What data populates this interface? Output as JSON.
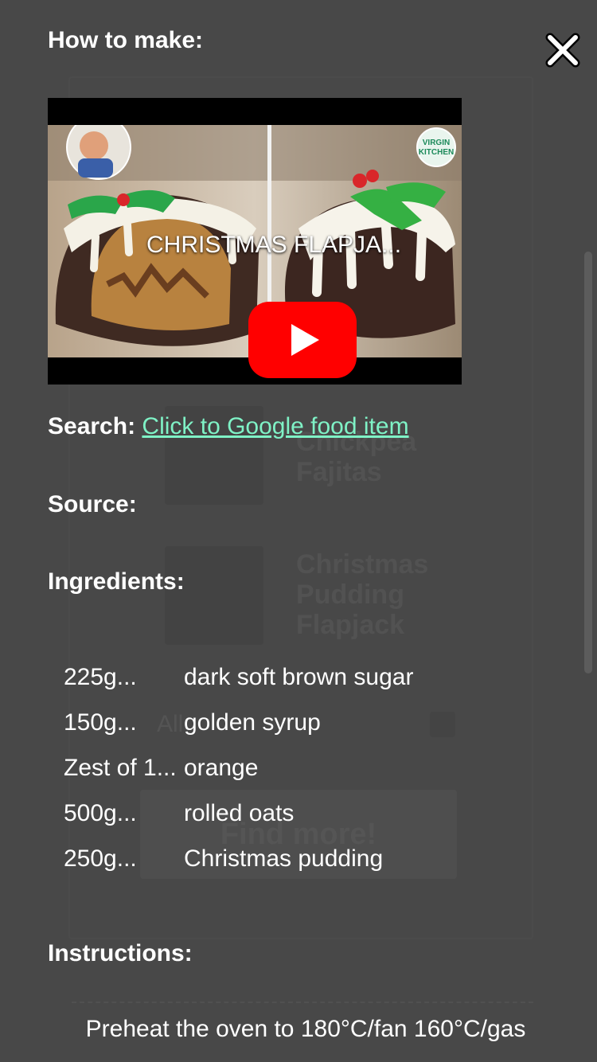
{
  "background": {
    "items": [
      {
        "title": "Chickpea\nFajitas"
      },
      {
        "title": "Christmas\nPudding\nFlapjack"
      }
    ],
    "filter_label": "All",
    "button_label": "Find more!"
  },
  "modal": {
    "how_to_make_label": "How to make:",
    "video": {
      "title": "CHRISTMAS FLAPJA...",
      "badge_lines": [
        "VIRGIN",
        "KITCHEN"
      ]
    },
    "search": {
      "label": "Search:",
      "link_text": "Click to Google food item"
    },
    "source": {
      "label": "Source:"
    },
    "ingredients": {
      "label": "Ingredients:",
      "items": [
        {
          "qty": "225g...",
          "name": "dark soft brown sugar"
        },
        {
          "qty": "150g...",
          "name": "golden syrup"
        },
        {
          "qty": "Zest of 1...",
          "name": "orange"
        },
        {
          "qty": "500g...",
          "name": "rolled oats"
        },
        {
          "qty": "250g...",
          "name": "Christmas pudding"
        }
      ]
    },
    "instructions": {
      "label": "Instructions:",
      "first_line": "Preheat the oven to 180°C/fan 160°C/gas"
    }
  },
  "icons": {
    "close": "close-icon",
    "play": "play-icon"
  },
  "colors": {
    "overlay": "#484848",
    "link": "#7ff2c6",
    "play_red": "#ff0000"
  }
}
